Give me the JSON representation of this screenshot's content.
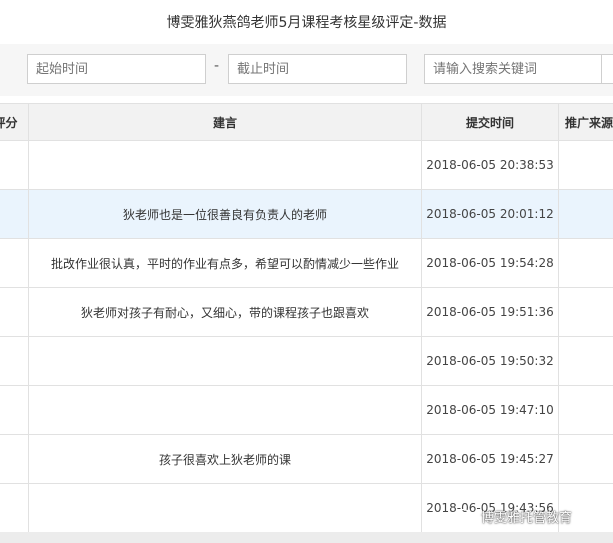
{
  "page": {
    "title": "博雯雅狄燕鸽老师5月课程考核星级评定-数据"
  },
  "filters": {
    "start_placeholder": "起始时间",
    "separator": "-",
    "end_placeholder": "截止时间",
    "search_placeholder": "请输入搜索关键词"
  },
  "table": {
    "headers": {
      "score": "评分",
      "suggestion": "建言",
      "submit_time": "提交时间",
      "source": "推广来源"
    },
    "rows": [
      {
        "suggestion": "",
        "time": "2018-06-05 20:38:53"
      },
      {
        "suggestion": "狄老师也是一位很善良有负责人的老师",
        "time": "2018-06-05 20:01:12"
      },
      {
        "suggestion": "批改作业很认真，平时的作业有点多，希望可以酌情减少一些作业",
        "time": "2018-06-05 19:54:28"
      },
      {
        "suggestion": "狄老师对孩子有耐心，又细心，带的课程孩子也跟喜欢",
        "time": "2018-06-05 19:51:36"
      },
      {
        "suggestion": "",
        "time": "2018-06-05 19:50:32"
      },
      {
        "suggestion": "",
        "time": "2018-06-05 19:47:10"
      },
      {
        "suggestion": "孩子很喜欢上狄老师的课",
        "time": "2018-06-05 19:45:27"
      },
      {
        "suggestion": "",
        "time": "2018-06-05 19:43:56"
      }
    ]
  },
  "watermark": {
    "text": "博雯雅托管教育",
    "icon": "wechat-icon"
  }
}
